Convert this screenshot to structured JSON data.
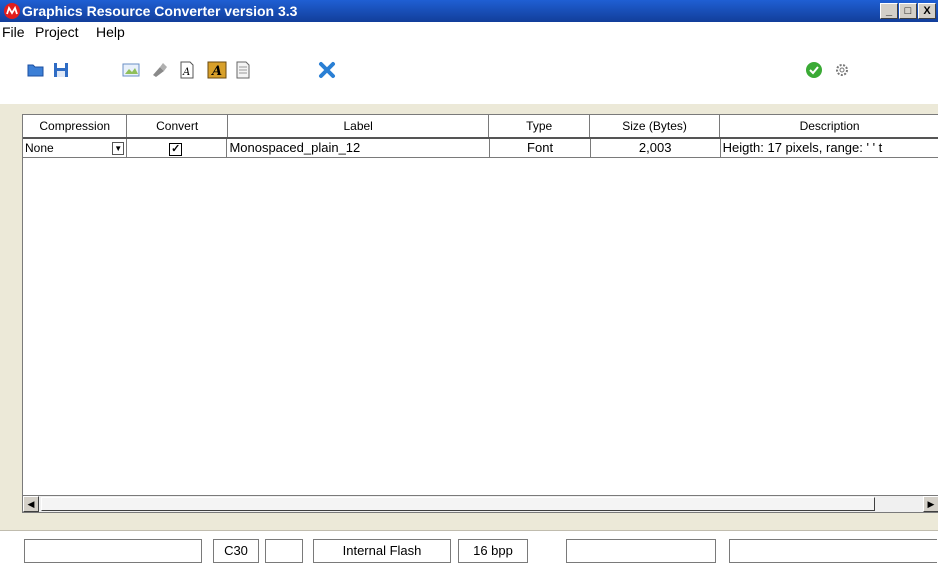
{
  "window": {
    "title": "Graphics Resource Converter version 3.3",
    "min": "_",
    "max": "□",
    "close": "X"
  },
  "menu": {
    "file": "File",
    "project": "Project",
    "help": "Help"
  },
  "toolbar": {
    "icons": [
      "open-folder-icon",
      "save-icon",
      "add-image-icon",
      "brush-icon",
      "add-font-icon",
      "font-a-icon",
      "document-icon",
      "delete-x-icon",
      "check-circle-icon",
      "settings-gear-icon"
    ]
  },
  "grid": {
    "headers": {
      "compression": "Compression",
      "convert": "Convert",
      "label": "Label",
      "type": "Type",
      "size": "Size (Bytes)",
      "description": "Description"
    },
    "rows": [
      {
        "compression": "None",
        "convert": "✓",
        "label": "Monospaced_plain_12",
        "type": "Font",
        "size": "2,003",
        "description": "Heigth: 17 pixels, range: ' ' t"
      }
    ]
  },
  "status": {
    "field1": "",
    "compiler": "C30",
    "field3": "",
    "memory": "Internal Flash",
    "bpp": "16 bpp",
    "field6": "",
    "field7": ""
  },
  "colors": {
    "titlebar": "#1f5fd3",
    "accent_check": "#3aaa35",
    "delete_x": "#2a7fd4"
  }
}
